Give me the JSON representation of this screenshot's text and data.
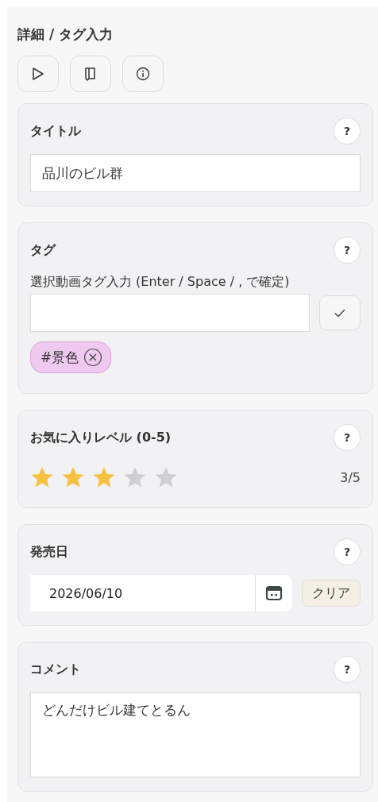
{
  "title": "詳細 / タグ入力",
  "toolbar": [
    {
      "kind": "play"
    },
    {
      "kind": "book"
    },
    {
      "kind": "info"
    }
  ],
  "sections": [
    {
      "kind": "text",
      "label": "タイトル",
      "help": "?",
      "value": "品川のビル群"
    },
    {
      "kind": "tags",
      "label": "タグ",
      "help": "?",
      "hint": "選択動画タグ入力 (Enter / Space / , で確定)",
      "tags": [
        {
          "label": "#景色"
        }
      ]
    },
    {
      "kind": "rating",
      "label": "お気に入りレベル (0-5)",
      "help": "?",
      "stars": 3,
      "reading": "3/5"
    },
    {
      "kind": "date",
      "label": "発売日",
      "help": "?",
      "value": "2026/06/10",
      "clear": "クリア"
    },
    {
      "kind": "textarea",
      "label": "コメント",
      "help": "?",
      "value": "どんだけビル建てとるん"
    }
  ]
}
